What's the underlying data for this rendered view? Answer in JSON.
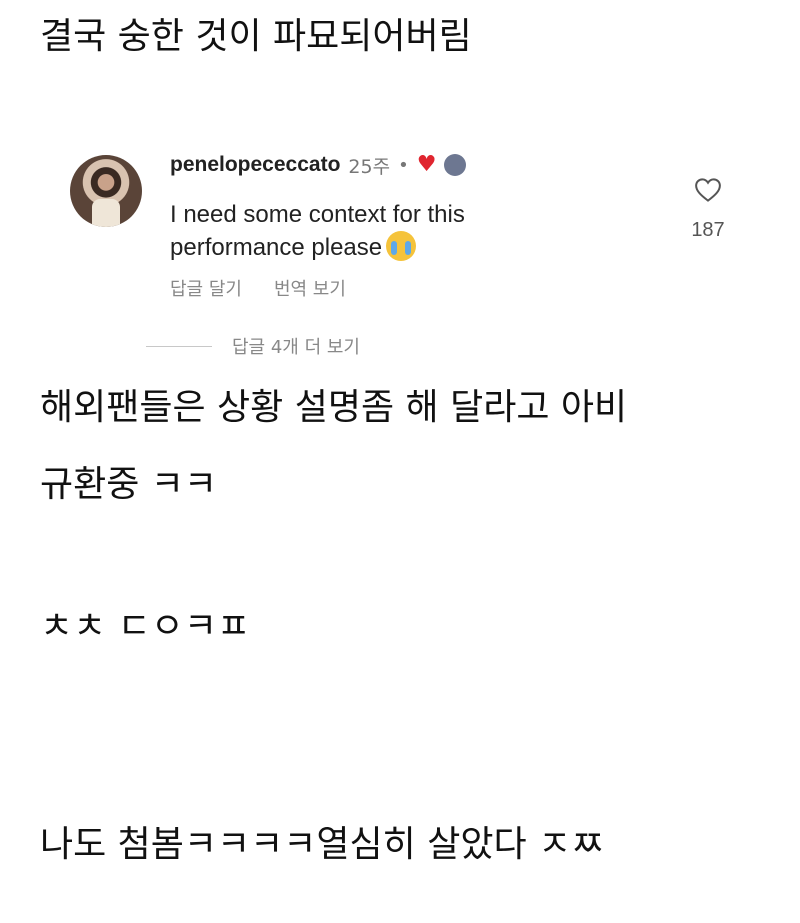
{
  "post": {
    "heading": "결국 숭한 것이 파묘되어버림",
    "paragraph1_line1": "해외팬들은 상황 설명좀 해 달라고 아비",
    "paragraph1_line2": "규환중 ㅋㅋ",
    "paragraph2": "ㅊㅊ ㄷㅇㅋㅍ",
    "paragraph3": "나도 첨봄ㅋㅋㅋㅋ열심히 살았다 ㅈㅉ"
  },
  "comment": {
    "username": "penelopececcato",
    "time": "25주",
    "separator": "•",
    "text": "I need some context for this performance please",
    "actions": {
      "reply": "답글 달기",
      "translate": "번역 보기"
    },
    "like_count": "187",
    "view_replies": "답글 4개 더 보기",
    "heart_color": "#e0252f"
  },
  "icons": {
    "avatar": "avatar-icon",
    "heart_badge": "heart-icon",
    "like": "heart-outline-icon",
    "emoji": "crying-face-emoji-icon"
  }
}
